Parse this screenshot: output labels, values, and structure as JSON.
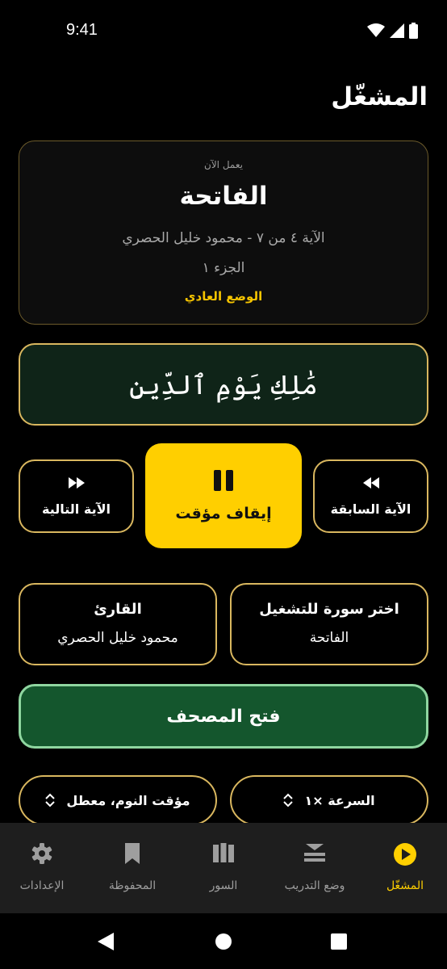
{
  "status": {
    "time": "9:41"
  },
  "page": {
    "title": "المشغّل"
  },
  "now_playing": {
    "label": "يعمل الآن",
    "surah": "الفاتحة",
    "meta": "الآية ٤ من ٧ - محمود خليل الحصري",
    "juz": "الجزء ١",
    "mode": "الوضع العادي"
  },
  "verse": {
    "text": "مَٰلِكِ يَوْمِ ٱلدِّينِ"
  },
  "controls": {
    "next_label": "الآية التالية",
    "pause_label": "إيقاف مؤقت",
    "prev_label": "الآية السابقة"
  },
  "selectors": {
    "reciter_title": "القارئ",
    "reciter_value": "محمود خليل الحصري",
    "surah_title": "اختر سورة للتشغيل",
    "surah_value": "الفاتحة"
  },
  "mushaf": {
    "label": "فتح المصحف"
  },
  "options": {
    "sleep_label": "مؤقت النوم، معطل",
    "speed_label": "السرعة ×١"
  },
  "nav": {
    "settings": "الإعدادات",
    "saved": "المحفوظة",
    "surahs": "السور",
    "training": "وضع التدريب",
    "player": "المشغّل"
  },
  "colors": {
    "accent": "#ffcf00",
    "border_gold": "#d9b75f",
    "verse_bg": "#0f2418",
    "mushaf_bg": "#14562d",
    "mushaf_border": "#8fd6a0"
  }
}
